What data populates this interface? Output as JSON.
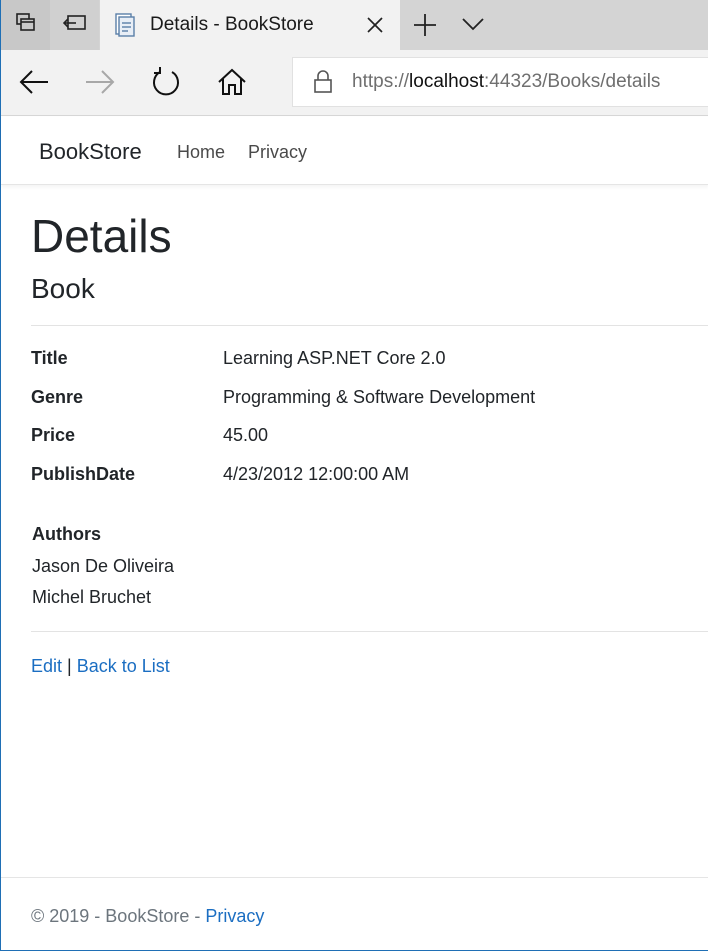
{
  "browser": {
    "tab_title": "Details - BookStore",
    "url_scheme": "https://",
    "url_host": "localhost",
    "url_rest": ":44323/Books/details"
  },
  "navbar": {
    "brand": "BookStore",
    "links": [
      "Home",
      "Privacy"
    ]
  },
  "page": {
    "title": "Details",
    "subtitle": "Book"
  },
  "details": [
    {
      "label": "Title",
      "value": "Learning ASP.NET Core 2.0"
    },
    {
      "label": "Genre",
      "value": "Programming & Software Development"
    },
    {
      "label": "Price",
      "value": "45.00"
    },
    {
      "label": "PublishDate",
      "value": "4/23/2012 12:00:00 AM"
    }
  ],
  "authors": {
    "label": "Authors",
    "names": [
      "Jason De Oliveira",
      "Michel Bruchet"
    ]
  },
  "actions": {
    "edit": "Edit",
    "separator": "|",
    "back": "Back to List"
  },
  "footer": {
    "text": "© 2019 - BookStore - ",
    "link": "Privacy"
  },
  "colors": {
    "link": "#1b6ec2",
    "text": "#212529",
    "muted": "#6c757d",
    "chrome_bg": "#f2f2f2"
  },
  "icons": {
    "tab_manager": "tab-manager-icon",
    "set_aside": "set-aside-tabs-icon",
    "favicon": "page-favicon-icon",
    "close": "close-icon",
    "new_tab": "plus-icon",
    "tab_list": "chevron-down-icon",
    "back": "arrow-left-icon",
    "forward": "arrow-right-icon",
    "refresh": "refresh-icon",
    "home": "home-icon",
    "lock": "lock-icon"
  }
}
